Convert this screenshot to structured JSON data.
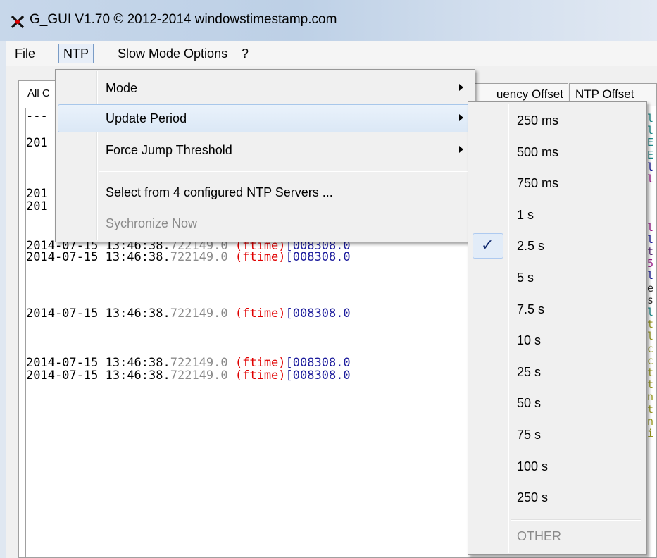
{
  "window": {
    "title": "G_GUI V1.70 © 2012-2014 windowstimestamp.com",
    "icon": "app-crossed-wrench-icon"
  },
  "menubar": {
    "items": [
      "File",
      "NTP",
      "Slow Mode Options",
      "?"
    ]
  },
  "tabs": {
    "all": "All C",
    "frequency": "uency Offset",
    "ntp_offset": "NTP Offset"
  },
  "log": {
    "lines": [
      {
        "prefix": "201"
      },
      {
        "prefix": "201"
      },
      {
        "prefix": "201"
      },
      {
        "date": "2014-07-15",
        "time": "13:46:38.",
        "frac": "722149.0",
        "src": "(ftime)",
        "id": "[008308.0"
      },
      {
        "date": "2014-07-15",
        "time": "13:46:38.",
        "frac": "722149.0",
        "src": "(ftime)",
        "id": "[008308.0"
      },
      {
        "date": "2014-07-15",
        "time": "13:46:38.",
        "frac": "722149.0",
        "src": "(ftime)",
        "id": "[008308.0"
      },
      {
        "date": "2014-07-15",
        "time": "13:46:38.",
        "frac": "722149.0",
        "src": "(ftime)",
        "id": "[008308.0"
      },
      {
        "date": "2014-07-15",
        "time": "13:46:38.",
        "frac": "722149.0",
        "src": "(ftime)",
        "id": "[008308.0"
      }
    ],
    "partial_top": "2014-07-15 13:46:38.722149.0 (ftime)[008308.0",
    "dashes": "---"
  },
  "ntp_menu": {
    "items": [
      {
        "label": "Mode",
        "submenu": true
      },
      {
        "label": "Update Period",
        "submenu": true,
        "highlighted": true
      },
      {
        "label": "Force Jump Threshold",
        "submenu": true
      },
      {
        "label": "Select from 4 configured NTP Servers ...",
        "submenu": false
      },
      {
        "label": "Sychronize Now",
        "submenu": false,
        "disabled": true
      }
    ]
  },
  "update_period_menu": {
    "items": [
      "250 ms",
      "500 ms",
      "750 ms",
      "1 s",
      "2.5 s",
      "5 s",
      "7.5 s",
      "10 s",
      "25 s",
      "50 s",
      "75 s",
      "100 s",
      "250 s"
    ],
    "checked": "2.5 s",
    "check_glyph": "✓",
    "other": "OTHER"
  },
  "colors": {
    "log_source": "#e00000",
    "log_id": "#1b1b9c",
    "log_fraction": "#8a8a8a",
    "menu_highlight_border": "#a8c7ea"
  }
}
